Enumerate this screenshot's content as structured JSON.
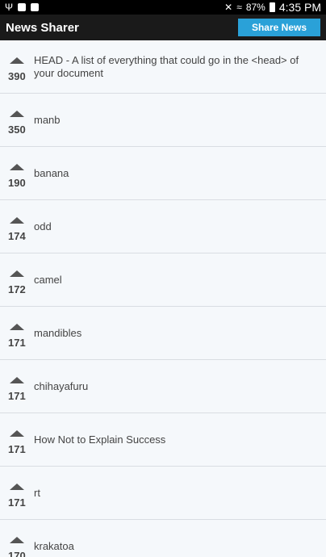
{
  "status_bar": {
    "battery": "87%",
    "time": "4:35 PM"
  },
  "app_bar": {
    "title": "News Sharer",
    "share_button_label": "Share News"
  },
  "items": [
    {
      "score": "390",
      "title": "HEAD - A list of everything that could go in the <head> of your document"
    },
    {
      "score": "350",
      "title": "manb"
    },
    {
      "score": "190",
      "title": "banana"
    },
    {
      "score": "174",
      "title": "odd"
    },
    {
      "score": "172",
      "title": "camel"
    },
    {
      "score": "171",
      "title": "mandibles"
    },
    {
      "score": "171",
      "title": "chihayafuru"
    },
    {
      "score": "171",
      "title": "How Not to Explain Success"
    },
    {
      "score": "171",
      "title": "rt"
    },
    {
      "score": "170",
      "title": "krakatoa"
    }
  ]
}
